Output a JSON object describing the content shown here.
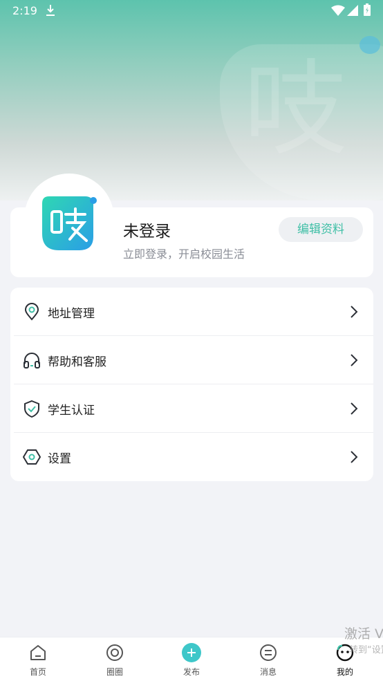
{
  "status_bar": {
    "time": "2:19"
  },
  "hero": {
    "glyph": "吱"
  },
  "profile": {
    "name": "未登录",
    "subtitle": "立即登录，开启校园生活",
    "edit_label": "编辑资料",
    "avatar_glyph": "吱"
  },
  "menu": {
    "items": [
      {
        "label": "地址管理",
        "icon": "location-pin-icon"
      },
      {
        "label": "帮助和客服",
        "icon": "headset-icon"
      },
      {
        "label": "学生认证",
        "icon": "shield-check-icon"
      },
      {
        "label": "设置",
        "icon": "hexagon-settings-icon"
      }
    ]
  },
  "watermark": {
    "line1": "激活 V",
    "line2": "转到“设置"
  },
  "tabbar": {
    "items": [
      {
        "label": "首页",
        "icon": "home-icon"
      },
      {
        "label": "圈圈",
        "icon": "circle-icon"
      },
      {
        "label": "发布",
        "icon": "add-icon"
      },
      {
        "label": "消息",
        "icon": "message-icon"
      },
      {
        "label": "我的",
        "icon": "profile-face-icon"
      }
    ],
    "active_index": 4
  },
  "colors": {
    "accent": "#3fbfa6",
    "hero_top": "#5dc3ad",
    "background": "#f2f3f7"
  }
}
